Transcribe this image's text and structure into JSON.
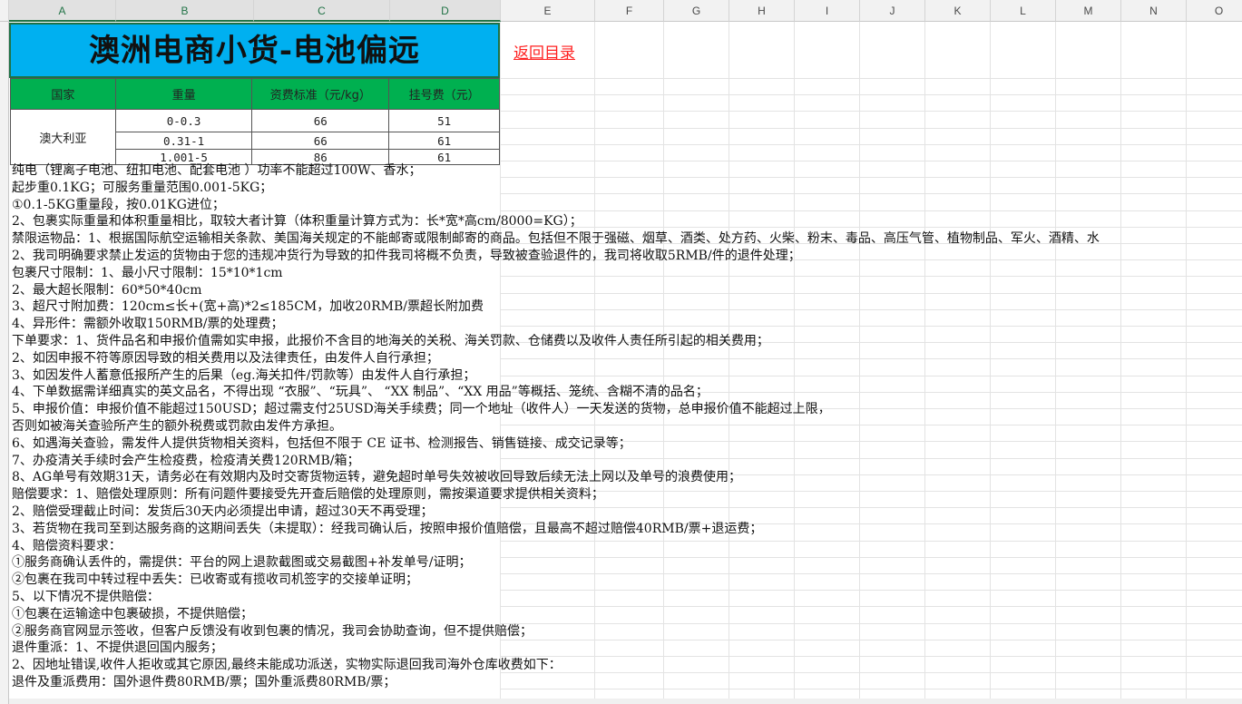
{
  "columns": [
    "A",
    "B",
    "C",
    "D",
    "E",
    "F",
    "G",
    "H",
    "I",
    "J",
    "K",
    "L",
    "M",
    "N",
    "O"
  ],
  "title": "澳洲电商小货-电池偏远",
  "back_link": "返回目录",
  "table": {
    "headers": [
      "国家",
      "重量",
      "资费标准（元/kg）",
      "挂号费（元）"
    ],
    "country": "澳大利亚",
    "rows": [
      {
        "weight": "0-0.3",
        "rate": "66",
        "fee": "51"
      },
      {
        "weight": "0.31-1",
        "rate": "66",
        "fee": "61"
      },
      {
        "weight": "1.001-5",
        "rate": "86",
        "fee": "61"
      }
    ]
  },
  "notes": [
    "纯电（锂离子电池、纽扣电池、配套电池 ）功率不能超过100W、香水；",
    "起步重0.1KG；可服务重量范围0.001-5KG；",
    "    ①0.1-5KG重量段，按0.01KG进位；",
    "2、包裹实际重量和体积重量相比，取较大者计算（体积重量计算方式为：长*宽*高cm/8000=KG）；",
    "禁限运物品：1、根据国际航空运输相关条款、美国海关规定的不能邮寄或限制邮寄的商品。包括但不限于强磁、烟草、酒类、处方药、火柴、粉末、毒品、高压气管、植物制品、军火、酒精、水",
    "2、我司明确要求禁止发运的货物由于您的违规冲货行为导致的扣件我司将概不负责，导致被查验退件的，我司将收取5RMB/件的退件处理；",
    "包裹尺寸限制：1、最小尺寸限制：15*10*1cm",
    "2、最大超长限制：60*50*40cm",
    "3、超尺寸附加费：120cm≤长+(宽+高)*2≤185CM，加收20RMB/票超长附加费",
    "4、异形件：需额外收取150RMB/票的处理费；",
    "下单要求：1、货件品名和申报价值需如实申报，此报价不含目的地海关的关税、海关罚款、仓储费以及收件人责任所引起的相关费用；",
    "2、如因申报不符等原因导致的相关费用以及法律责任，由发件人自行承担；",
    "3、如因发件人蓄意低报所产生的后果（eg.海关扣件/罚款等）由发件人自行承担；",
    "4、下单数据需详细真实的英文品名，不得出现 “衣服”、“玩具”、 “XX 制品”、“XX 用品”等概括、笼统、含糊不清的品名；",
    "5、申报价值：申报价值不能超过150USD；超过需支付25USD海关手续费；同一个地址（收件人）一天发送的货物，总申报价值不能超过上限，",
    "否则如被海关查验所产生的额外税费或罚款由发件方承担。",
    "6、如遇海关查验，需发件人提供货物相关资料，包括但不限于 CE 证书、检测报告、销售链接、成交记录等；",
    "7、办疫清关手续时会产生检疫费，检疫清关费120RMB/箱；",
    "8、AG单号有效期31天，请务必在有效期内及时交寄货物运转，避免超时单号失效被收回导致后续无法上网以及单号的浪费使用；",
    "赔偿要求：1、赔偿处理原则：所有问题件要接受先开查后赔偿的处理原则，需按渠道要求提供相关资料；",
    "2、赔偿受理截止时间：发货后30天内必须提出申请，超过30天不再受理；",
    "3、若货物在我司至到达服务商的这期间丢失（未提取）：经我司确认后，按照申报价值赔偿，且最高不超过赔偿40RMB/票+退运费；",
    "4、赔偿资料要求：",
    "①服务商确认丢件的，需提供：平台的网上退款截图或交易截图+补发单号/证明；",
    "②包裹在我司中转过程中丢失：已收寄或有揽收司机签字的交接单证明；",
    "5、以下情况不提供赔偿：",
    "①包裹在运输途中包裹破损，不提供赔偿；",
    "②服务商官网显示签收，但客户反馈没有收到包裹的情况，我司会协助查询，但不提供赔偿；",
    "退件重派：1、不提供退回国内服务；",
    "2、因地址错误,收件人拒收或其它原因,最终未能成功派送，实物实际退回我司海外仓库收费如下：",
    "退件及重派费用：国外退件费80RMB/票；国外重派费80RMB/票；"
  ]
}
